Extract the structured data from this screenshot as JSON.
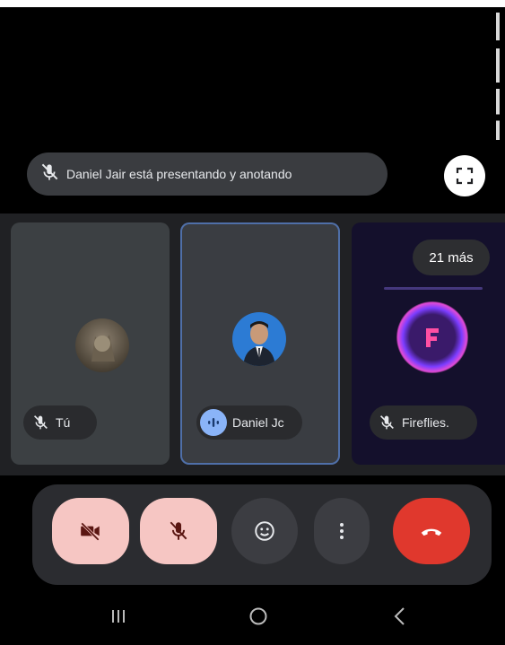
{
  "banner": {
    "presenting_text": "Daniel Jair está presentando y anotando"
  },
  "tiles": [
    {
      "id": "you",
      "name": "Tú",
      "muted": true
    },
    {
      "id": "daniel",
      "name": "Daniel Jc",
      "speaking": true
    },
    {
      "id": "fireflies",
      "name": "Fireflies.",
      "muted": true
    }
  ],
  "more_participants": "21 más",
  "controls": {
    "camera": "camera-off-icon",
    "mic": "mic-off-icon",
    "emoji": "emoji-icon",
    "more": "more-vert-icon",
    "end": "end-call-icon"
  },
  "colors": {
    "muted_control_bg": "#f6c6c3",
    "end_call": "#e0382d",
    "speaking_accent": "#8ab4f8"
  }
}
